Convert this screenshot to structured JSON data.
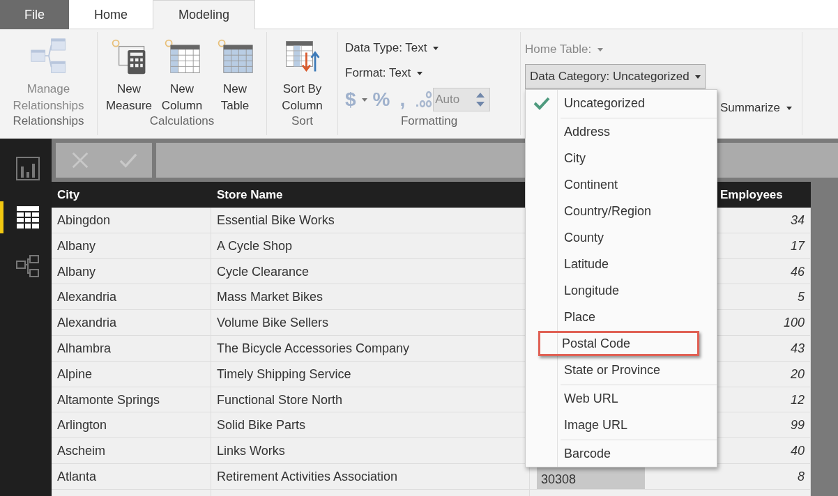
{
  "tabs": [
    {
      "label": "File",
      "kind": "file",
      "selected": false
    },
    {
      "label": "Home",
      "kind": "tab",
      "selected": false
    },
    {
      "label": "Modeling",
      "kind": "tab",
      "selected": true
    }
  ],
  "ribbon": {
    "groups": [
      {
        "label": "Relationships",
        "buttons": [
          {
            "label": "Manage Relationships",
            "kind": "relationships",
            "disabled": true
          }
        ]
      },
      {
        "label": "Calculations",
        "buttons": [
          {
            "label": "New Measure",
            "kind": "measure",
            "disabled": false
          },
          {
            "label": "New Column",
            "kind": "column",
            "disabled": false
          },
          {
            "label": "New Table",
            "kind": "table",
            "disabled": false
          }
        ]
      },
      {
        "label": "Sort",
        "buttons": [
          {
            "label": "Sort By Column",
            "kind": "sort",
            "disabled": false
          }
        ]
      }
    ],
    "formatting": {
      "label": "Formatting",
      "data_type": "Data Type: Text",
      "format": "Format: Text",
      "currency": "$",
      "percent": "%",
      "comma": ",",
      "decimals": "Auto"
    },
    "properties": {
      "home_table": "Home Table:",
      "data_category": "Data Category: Uncategorized",
      "summarize": "Summarize"
    }
  },
  "sidebar": {
    "items": [
      {
        "kind": "report",
        "selected": false
      },
      {
        "kind": "data",
        "selected": true
      },
      {
        "kind": "model",
        "selected": false
      }
    ]
  },
  "table": {
    "columns": [
      "City",
      "Store Name",
      "Employees"
    ],
    "rows": [
      {
        "city": "Abingdon",
        "store": "Essential Bike Works",
        "employees": "34"
      },
      {
        "city": "Albany",
        "store": "A Cycle Shop",
        "employees": "17"
      },
      {
        "city": "Albany",
        "store": "Cycle Clearance",
        "employees": "46"
      },
      {
        "city": "Alexandria",
        "store": "Mass Market Bikes",
        "employees": "5"
      },
      {
        "city": "Alexandria",
        "store": "Volume Bike Sellers",
        "employees": "100"
      },
      {
        "city": "Alhambra",
        "store": "The Bicycle Accessories Company",
        "employees": "43"
      },
      {
        "city": "Alpine",
        "store": "Timely Shipping Service",
        "employees": "20"
      },
      {
        "city": "Altamonte Springs",
        "store": "Functional Store North",
        "employees": "12"
      },
      {
        "city": "Arlington",
        "store": "Solid Bike Parts",
        "employees": "99"
      },
      {
        "city": "Ascheim",
        "store": "Links Works",
        "employees": "40"
      },
      {
        "city": "Atlanta",
        "store": "Retirement Activities Association",
        "column_3": "30308",
        "employees": "8"
      }
    ]
  },
  "menu": {
    "groups": [
      [
        {
          "label": "Uncategorized",
          "selected": true,
          "highlighted": false
        }
      ],
      [
        {
          "label": "Address",
          "selected": false,
          "highlighted": false
        },
        {
          "label": "City",
          "selected": false,
          "highlighted": false
        },
        {
          "label": "Continent",
          "selected": false,
          "highlighted": false
        },
        {
          "label": "Country/Region",
          "selected": false,
          "highlighted": false
        },
        {
          "label": "County",
          "selected": false,
          "highlighted": false
        },
        {
          "label": "Latitude",
          "selected": false,
          "highlighted": false
        },
        {
          "label": "Longitude",
          "selected": false,
          "highlighted": false
        },
        {
          "label": "Place",
          "selected": false,
          "highlighted": false
        },
        {
          "label": "Postal Code",
          "selected": false,
          "highlighted": true
        },
        {
          "label": "State or Province",
          "selected": false,
          "highlighted": false
        }
      ],
      [
        {
          "label": "Web URL",
          "selected": false,
          "highlighted": false
        },
        {
          "label": "Image URL",
          "selected": false,
          "highlighted": false
        }
      ],
      [
        {
          "label": "Barcode",
          "selected": false,
          "highlighted": false
        }
      ]
    ]
  }
}
